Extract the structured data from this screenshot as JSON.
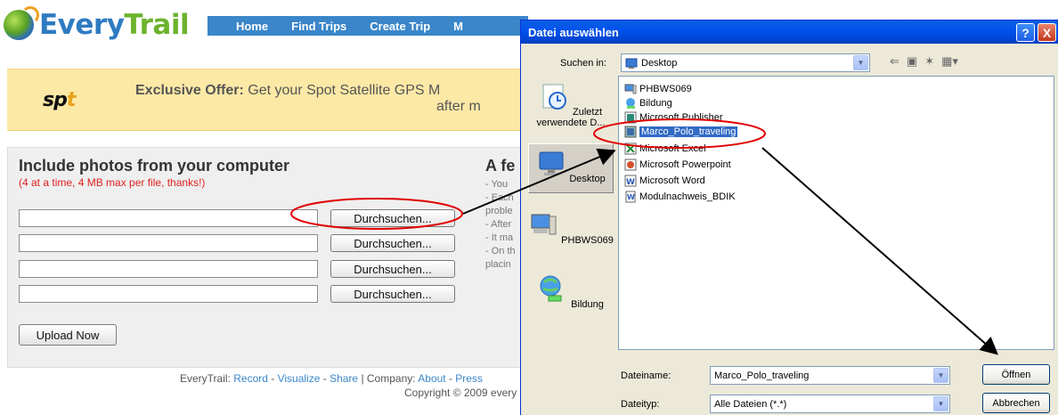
{
  "site": {
    "logo_text_every": "Every",
    "logo_text_trail": "Trail",
    "nav": [
      "Home",
      "Find Trips",
      "Create Trip",
      "M"
    ]
  },
  "offer": {
    "brand": "sp",
    "brand_accent": "t",
    "headline_bold": "Exclusive Offer:",
    "headline_rest": " Get your Spot Satellite GPS M",
    "line2": "after m"
  },
  "upload": {
    "title": "Include photos from your computer",
    "subtitle": "(4 at a time, 4 MB max per file, thanks!)",
    "browse_label": "Durchsuchen...",
    "upload_button": "Upload Now"
  },
  "tips": {
    "title": "A fe",
    "lines": [
      "- You",
      "- Each",
      "proble",
      "- After",
      "- It ma",
      "- On th",
      "placin"
    ]
  },
  "footer": {
    "prefix": "EveryTrail: ",
    "link_record": "Record",
    "link_visualize": "Visualize",
    "link_share": "Share",
    "company": " | Company: ",
    "link_about": "About",
    "link_press": "Press",
    "copyright": "Copyright © 2009 every"
  },
  "dialog": {
    "title": "Datei auswählen",
    "help_glyph": "?",
    "close_glyph": "X",
    "look_in_label": "Suchen in:",
    "look_in_value": "Desktop",
    "places": [
      {
        "label": "Zuletzt verwendete D...",
        "icon": "recent-docs-icon"
      },
      {
        "label": "Desktop",
        "icon": "desktop-icon"
      },
      {
        "label": "PHBWS069",
        "icon": "my-computer-icon"
      },
      {
        "label": "Bildung",
        "icon": "network-icon"
      }
    ],
    "files": [
      {
        "name": "PHBWS069",
        "icon": "computer-icon"
      },
      {
        "name": "Bildung",
        "icon": "network-icon"
      },
      {
        "name": "Microsoft Publisher",
        "icon": "shortcut-icon"
      },
      {
        "name": "Marco_Polo_traveling",
        "icon": "shortcut-icon"
      },
      {
        "name": "Microsoft Excel",
        "icon": "excel-icon"
      },
      {
        "name": "Microsoft Powerpoint",
        "icon": "powerpoint-icon"
      },
      {
        "name": "Microsoft Word",
        "icon": "word-icon"
      },
      {
        "name": "Modulnachweis_BDIK",
        "icon": "word-doc-icon"
      }
    ],
    "selected_file": "Marco_Polo_traveling",
    "filename_label": "Dateiname:",
    "filename_value": "Marco_Polo_traveling",
    "filetype_label": "Dateityp:",
    "filetype_value": "Alle Dateien (*.*)",
    "open_button": "Öffnen",
    "cancel_button": "Abbrechen"
  },
  "colors": {
    "nav_blue": "#3a86c9",
    "offer_bg": "#fde9a6",
    "xp_title": "#0053ee",
    "annotation_red": "#e00000"
  }
}
